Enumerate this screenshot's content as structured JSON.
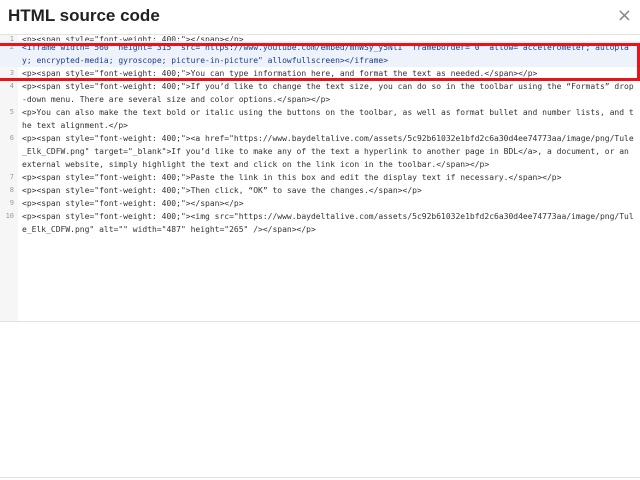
{
  "dialog": {
    "title": "HTML source code",
    "close_icon": "×"
  },
  "editor": {
    "lines": [
      {
        "n": "1",
        "text": "<p><span style=\"font-weight: 400;\"></span></p>"
      },
      {
        "n": "2",
        "text": "<iframe width=\"560\" height=\"315\" src=\"https://www.youtube.com/embed/mhWSy_y5NlI\" frameborder=\"0\" allow=\"accelerometer; autoplay; encrypted-media; gyroscope; picture-in-picture\" allowfullscreen></iframe>"
      },
      {
        "n": "3",
        "text": "<p><span style=\"font-weight: 400;\">You can type information here, and format the text as needed.</span></p>"
      },
      {
        "n": "4",
        "text": "<p><span style=\"font-weight: 400;\">If you’d like to change the text size, you can do so in the toolbar using the “Formats” drop-down menu. There are several size and color options.</span></p>"
      },
      {
        "n": "5",
        "text": "<p>You can also make the text bold or italic using the buttons on the toolbar, as well as format bullet and number lists, and the text alignment.</p>"
      },
      {
        "n": "6",
        "text": "<p><span style=\"font-weight: 400;\"><a href=\"https://www.baydeltalive.com/assets/5c92b61032e1bfd2c6a30d4ee74773aa/image/png/Tule_Elk_CDFW.png\" target=\"_blank\">If you’d like to make any of the text a hyperlink to another page in BDL</a>, a document, or an external website, simply highlight the text and click on the link icon in the toolbar.</span></p>"
      },
      {
        "n": "7",
        "text": "<p><span style=\"font-weight: 400;\">Paste the link in this box and edit the display text if necessary.</span></p>"
      },
      {
        "n": "8",
        "text": "<p><span style=\"font-weight: 400;\">Then click, “OK” to save the changes.</span></p>"
      },
      {
        "n": "9",
        "text": "<p><span style=\"font-weight: 400;\"></span></p>"
      },
      {
        "n": "10",
        "text": "<p><span style=\"font-weight: 400;\"><img src=\"https://www.baydeltalive.com/assets/5c92b61032e1bfd2c6a30d4ee74773aa/image/png/Tule_Elk_CDFW.png\" alt=\"\" width=\"487\" height=\"265\" /></span></p>"
      }
    ]
  },
  "colors": {
    "highlight_box": "#e8141a",
    "highlight_bg": "#eef3fb"
  }
}
